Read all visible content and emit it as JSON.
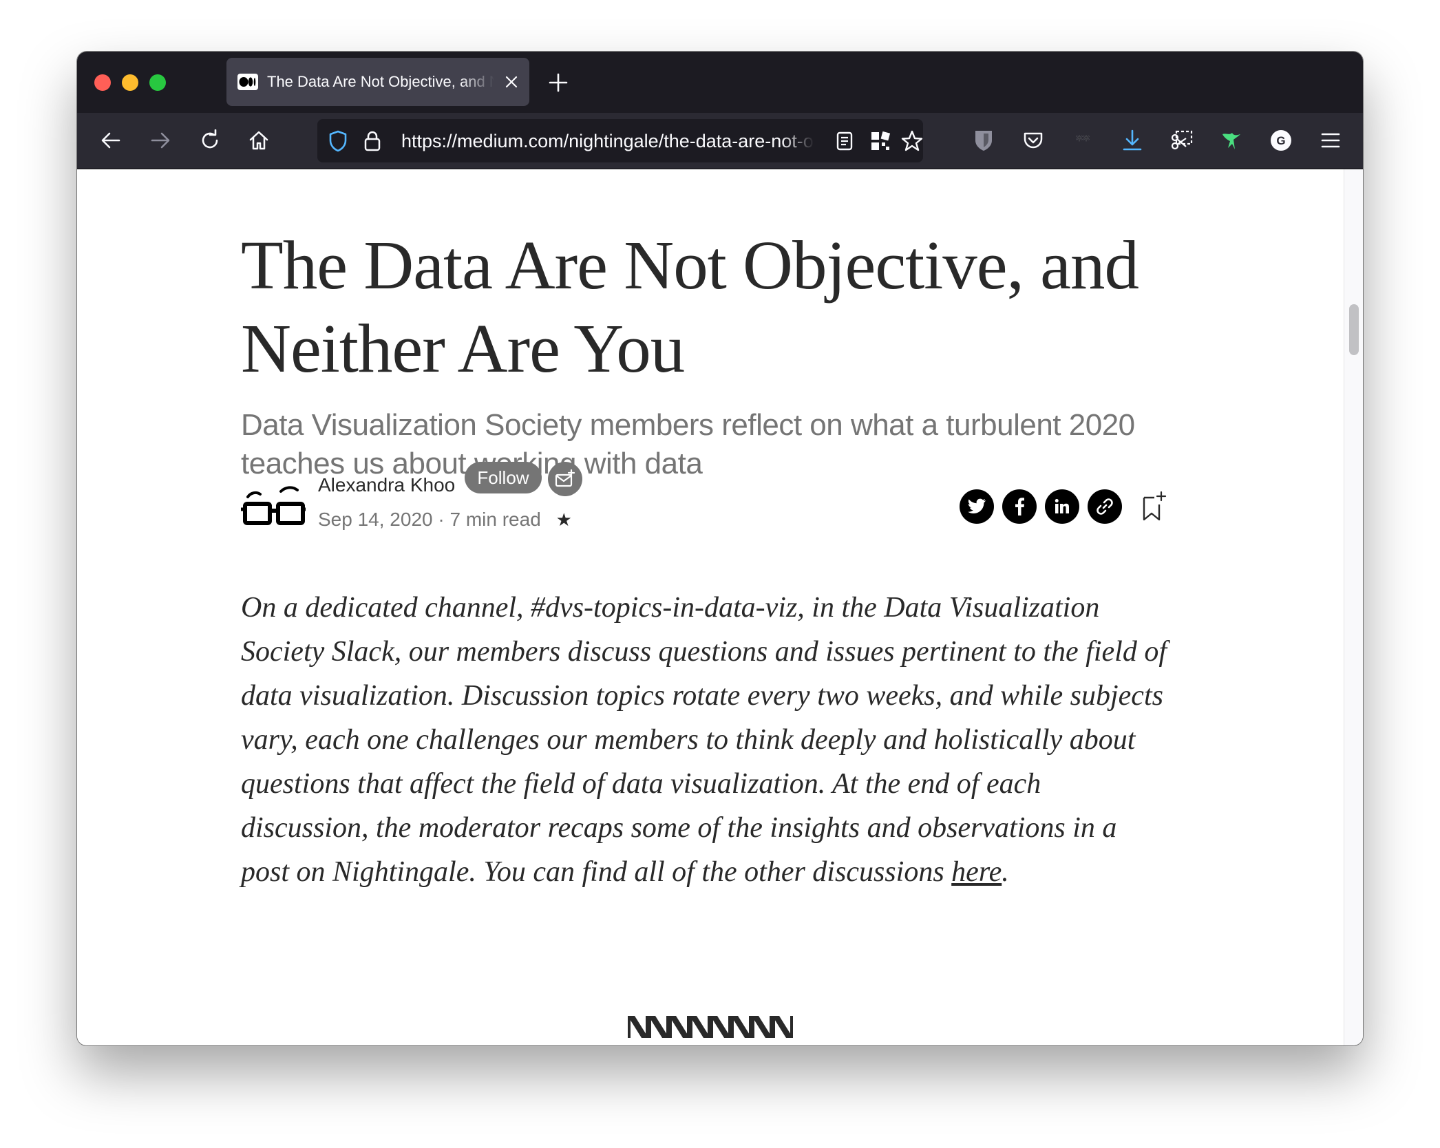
{
  "browser": {
    "tab": {
      "title": "The Data Are Not Objective, and Neither Are You",
      "favicon": "medium-logo-icon"
    },
    "url": "https://medium.com/nightingale/the-data-are-not-objective-and-neither-are-you"
  },
  "article": {
    "title_lines": [
      "The Data Are Not Objective, and",
      "Neither Are You"
    ],
    "subtitle_lines": [
      "Data Visualization Society members reflect on what a turbulent 2020",
      "teaches us about working with data"
    ],
    "author": {
      "name": "Alexandra Khoo",
      "follow_label": "Follow"
    },
    "meta": {
      "date": "Sep 14, 2020",
      "separator": "·",
      "read_time": "7 min read",
      "star": "★"
    },
    "share_icons": [
      "twitter-icon",
      "facebook-icon",
      "linkedin-icon",
      "link-icon"
    ],
    "body_lines": [
      "On a dedicated channel, #dvs-topics-in-data-viz, in the Data Visualization",
      "Society Slack, our members discuss questions and issues pertinent to the field of",
      "data visualization. Discussion topics rotate every two weeks, and while subjects",
      "vary, each one challenges our members to think deeply and holistically about",
      "questions that affect the field of data visualization. At the end of each",
      "discussion, the moderator recaps some of the insights and observations in a"
    ],
    "body_last_line": {
      "before": "post on Nightingale. You can find all of the other discussions ",
      "link": "here",
      "after": "."
    }
  },
  "colors": {
    "tabbar": "#1c1b22",
    "navbar": "#2b2a33",
    "text_primary": "#292929",
    "text_secondary": "#757575",
    "accent_download": "#54b7ff",
    "accent_extension": "#4ade80"
  }
}
